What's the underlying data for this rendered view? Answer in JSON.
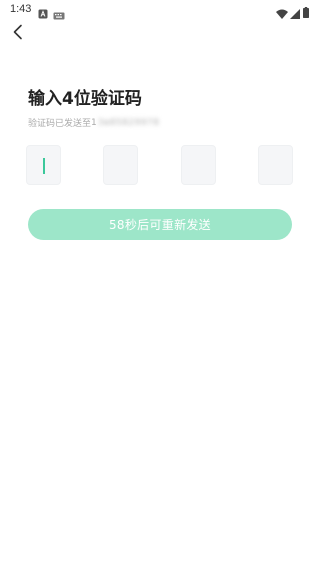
{
  "status_bar": {
    "time": "1:43",
    "icons": [
      "notification-a-icon",
      "keyboard-icon",
      "wifi-icon",
      "signal-icon",
      "battery-icon"
    ]
  },
  "nav": {
    "back_icon": "chevron-left-icon"
  },
  "title": "输入4位验证码",
  "sent_prefix": "验证码已发送至",
  "phone_visible_digit": "1",
  "phone_masked": "3ʙ85829978",
  "code_inputs": [
    "",
    "",
    "",
    ""
  ],
  "resend_label": "58秒后可重新发送",
  "colors": {
    "accent": "#3cc89b",
    "button_disabled_bg": "#9de6c9",
    "input_bg": "#f5f6f8"
  }
}
